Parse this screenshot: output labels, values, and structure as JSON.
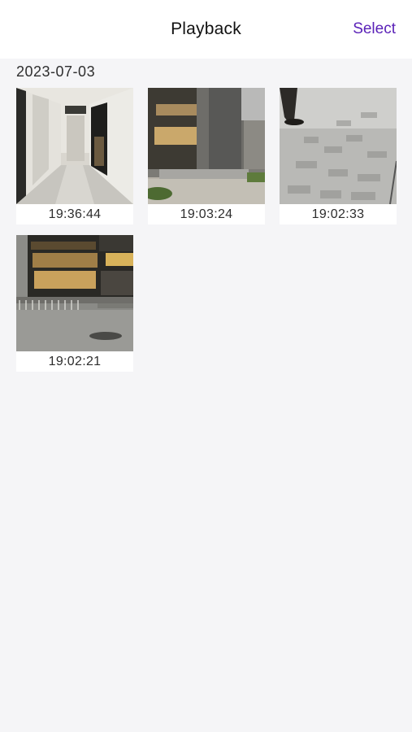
{
  "header": {
    "title": "Playback",
    "select_label": "Select"
  },
  "group": {
    "date": "2023-07-03",
    "items": [
      {
        "time": "19:36:44",
        "scene": "hallway"
      },
      {
        "time": "19:03:24",
        "scene": "plaza-building"
      },
      {
        "time": "19:02:33",
        "scene": "pavement"
      },
      {
        "time": "19:02:21",
        "scene": "mall-exterior-night"
      }
    ]
  },
  "colors": {
    "accent": "#5b22b8",
    "background": "#f5f5f7"
  }
}
